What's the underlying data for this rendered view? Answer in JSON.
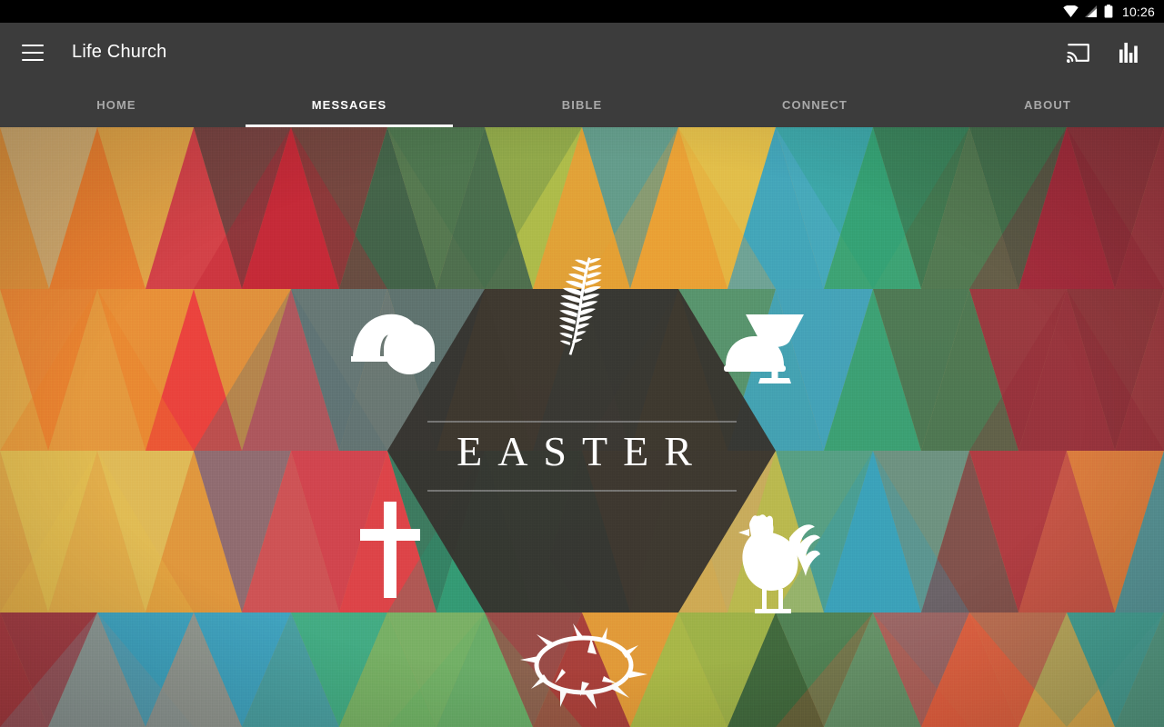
{
  "status_bar": {
    "time": "10:26",
    "icons": [
      "wifi-icon",
      "cellular-signal-icon",
      "battery-icon"
    ]
  },
  "toolbar": {
    "menu_icon": "hamburger-menu-icon",
    "title": "Life Church",
    "actions": [
      {
        "name": "cast-icon",
        "label": "Cast"
      },
      {
        "name": "equalizer-icon",
        "label": "Now Playing"
      }
    ]
  },
  "tabs": [
    {
      "label": "HOME",
      "active": false
    },
    {
      "label": "MESSAGES",
      "active": true
    },
    {
      "label": "BIBLE",
      "active": false
    },
    {
      "label": "CONNECT",
      "active": false
    },
    {
      "label": "ABOUT",
      "active": false
    }
  ],
  "hero": {
    "series_title": "EASTER",
    "symbols": [
      {
        "name": "palm-branch-icon",
        "label": "Palm Branch"
      },
      {
        "name": "empty-tomb-icon",
        "label": "Empty Tomb"
      },
      {
        "name": "chalice-bread-icon",
        "label": "Chalice and Bread"
      },
      {
        "name": "cross-icon",
        "label": "Cross"
      },
      {
        "name": "rooster-icon",
        "label": "Rooster"
      },
      {
        "name": "crown-of-thorns-icon",
        "label": "Crown of Thorns"
      }
    ]
  },
  "colors": {
    "status_bar_bg": "#000000",
    "toolbar_bg": "#3c3c3c",
    "tab_active": "#ffffff",
    "tab_inactive": "#a9a9a9",
    "hero_center_panel": "#2b2b2b",
    "paper_base": "#cfa86a"
  }
}
